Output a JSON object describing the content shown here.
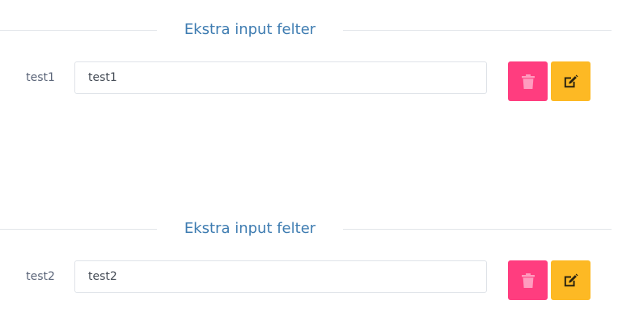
{
  "sections": [
    {
      "title": "Ekstra input felter",
      "label": "test1",
      "value": "test1",
      "delete_icon": "trash-icon",
      "edit_icon": "edit-icon"
    },
    {
      "title": "Ekstra input felter",
      "label": "test2",
      "value": "test2",
      "delete_icon": "trash-icon",
      "edit_icon": "edit-icon"
    }
  ],
  "colors": {
    "title": "#3e7cb1",
    "delete_button": "#ff3d7f",
    "edit_button": "#fdb924",
    "divider": "#e2e6ea"
  }
}
